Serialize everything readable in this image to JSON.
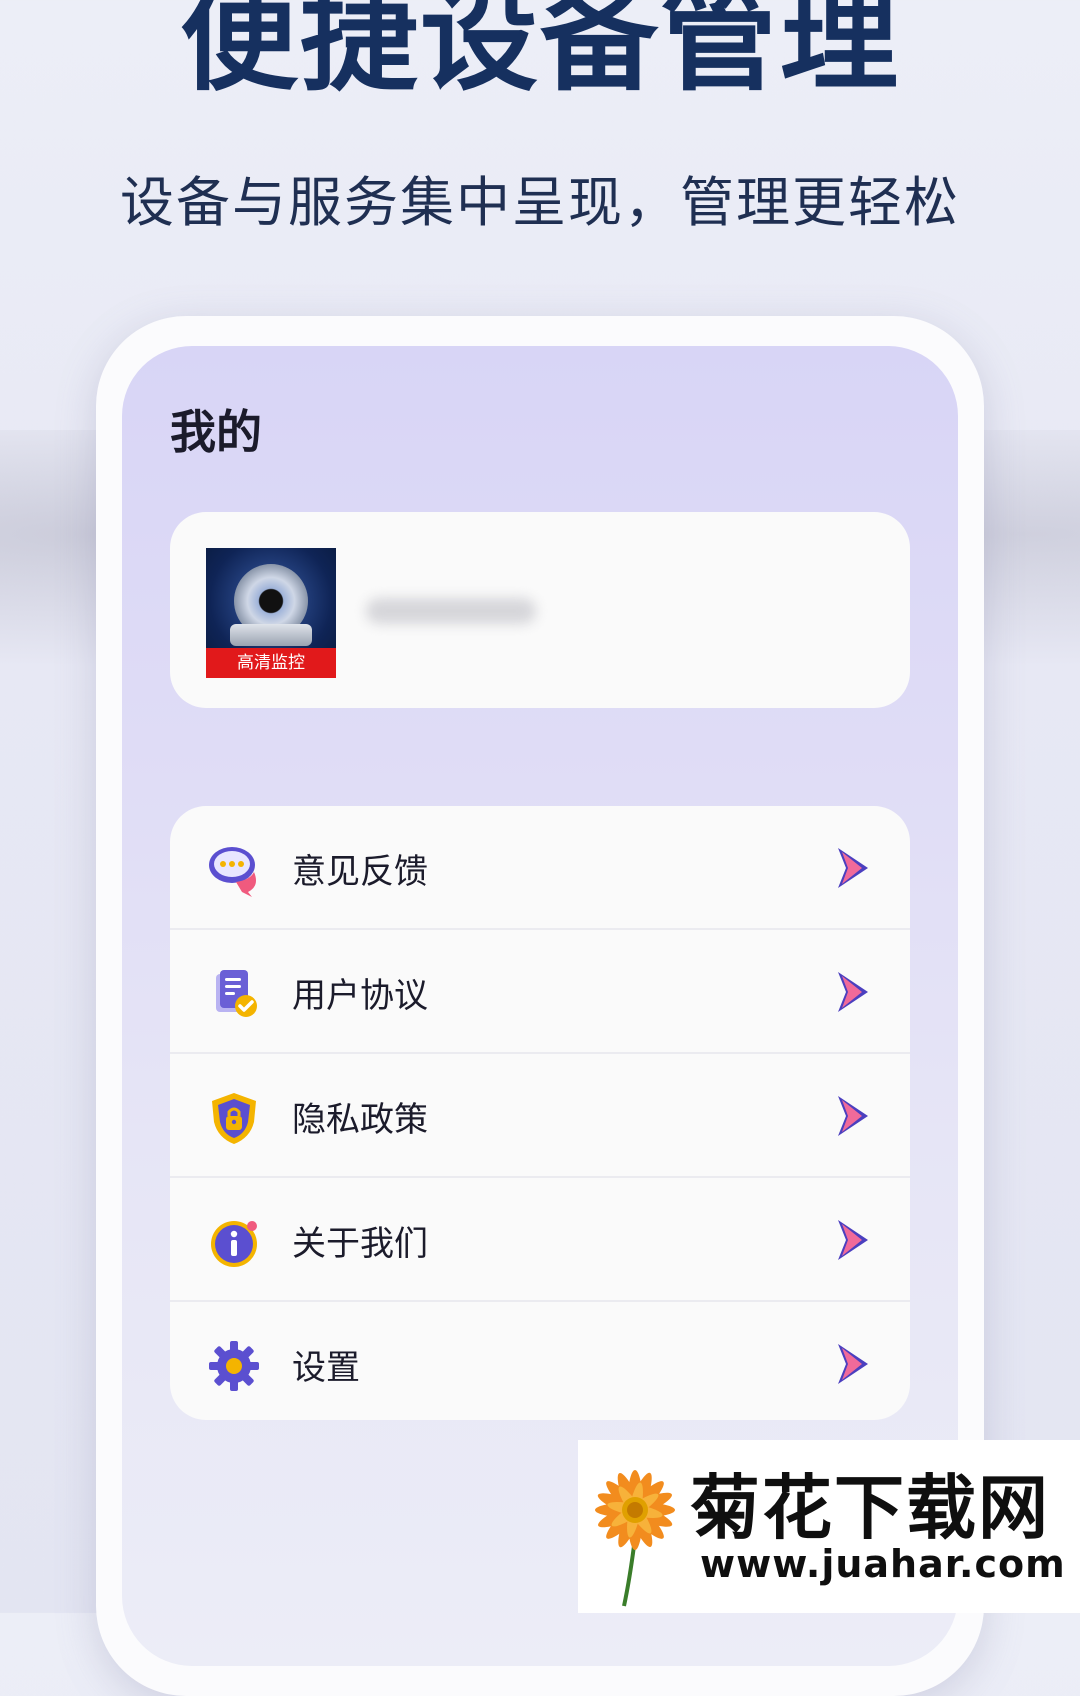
{
  "headline": "便捷设备管理",
  "subhead": "设备与服务集中呈现，管理更轻松",
  "screen": {
    "title": "我的",
    "profile": {
      "avatar_banner": "高清监控"
    },
    "menu": [
      {
        "label": "意见反馈",
        "icon": "feedback-chat-icon"
      },
      {
        "label": "用户协议",
        "icon": "document-check-icon"
      },
      {
        "label": "隐私政策",
        "icon": "shield-lock-icon"
      },
      {
        "label": "关于我们",
        "icon": "info-icon"
      },
      {
        "label": "设置",
        "icon": "gear-icon"
      }
    ],
    "accent_color": "#5a4fcf"
  },
  "watermark": {
    "title": "菊花下载网",
    "url": "www.juahar.com"
  }
}
